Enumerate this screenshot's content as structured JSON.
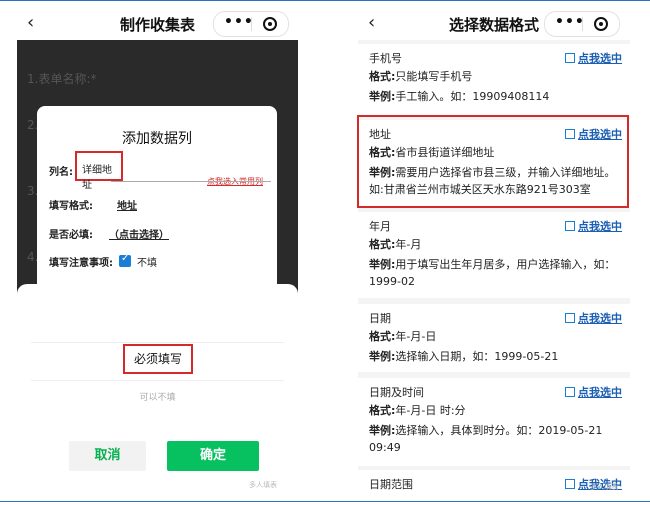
{
  "left": {
    "nav_title": "制作收集表",
    "back_icon": "chevron-left-icon",
    "bg_labels": [
      "1.表单名称:*",
      "2.",
      "3.",
      "4."
    ],
    "dialog": {
      "title": "添加数据列",
      "name_label": "列名:",
      "name_value": "详细地址",
      "common_link": "点我选入常用列",
      "format_label": "填写格式:",
      "format_value": "地址",
      "required_label": "是否必填:",
      "required_value": "（点击选择）",
      "notes_label": "填写注意事项:",
      "notes_value": "不填"
    },
    "sheet": {
      "option_required": "必须填写",
      "option_optional": "可以不填",
      "cancel": "取消",
      "confirm": "确定",
      "watermark": "多人填表"
    }
  },
  "right": {
    "nav_title": "选择数据格式",
    "action_label": "点我选中",
    "sections": [
      {
        "title": "手机号",
        "format_label": "格式:",
        "format": "只能填写手机号",
        "example_label": "举例:",
        "example": "手工输入。如：19909408114"
      },
      {
        "title": "地址",
        "format_label": "格式:",
        "format": "省市县街道详细地址",
        "example_label": "举例:",
        "example": "需要用户选择省市县三级，并输入详细地址。如:甘肃省兰州市城关区天水东路921号303室"
      },
      {
        "title": "年月",
        "format_label": "格式:",
        "format": "年-月",
        "example_label": "举例:",
        "example": "用于填写出生年月居多，用户选择输入，如：1999-02"
      },
      {
        "title": "日期",
        "format_label": "格式:",
        "format": "年-月-日",
        "example_label": "举例:",
        "example": "选择输入日期，如：1999-05-21"
      },
      {
        "title": "日期及时间",
        "format_label": "格式:",
        "format": "年-月-日 时:分",
        "example_label": "举例:",
        "example": "选择输入，具体到时分。如：2019-05-21 09:49"
      },
      {
        "title": "日期范围"
      }
    ],
    "watermark": "多人填表"
  },
  "colors": {
    "accent_green": "#07c160",
    "highlight_red": "#d42a2a",
    "link_blue": "#1a5fb4"
  }
}
